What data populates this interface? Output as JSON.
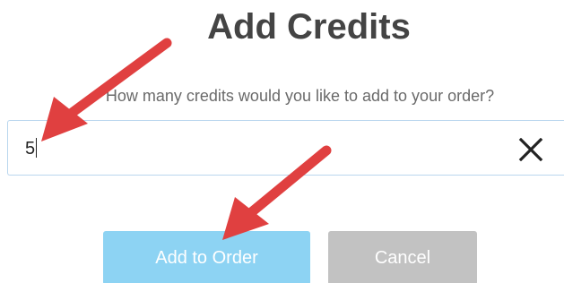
{
  "dialog": {
    "title": "Add Credits",
    "question": "How many credits would you like to add to your order?",
    "credits_input": {
      "value": "5"
    },
    "clear_icon": "close-x-icon",
    "add_button_label": "Add to Order",
    "cancel_button_label": "Cancel"
  },
  "annotations": {
    "arrow_color": "#e04040"
  },
  "colors": {
    "title": "#444444",
    "primary_button": "#8dd3f3",
    "secondary_button": "#c2c2c2",
    "input_border": "#b9d6ee"
  }
}
